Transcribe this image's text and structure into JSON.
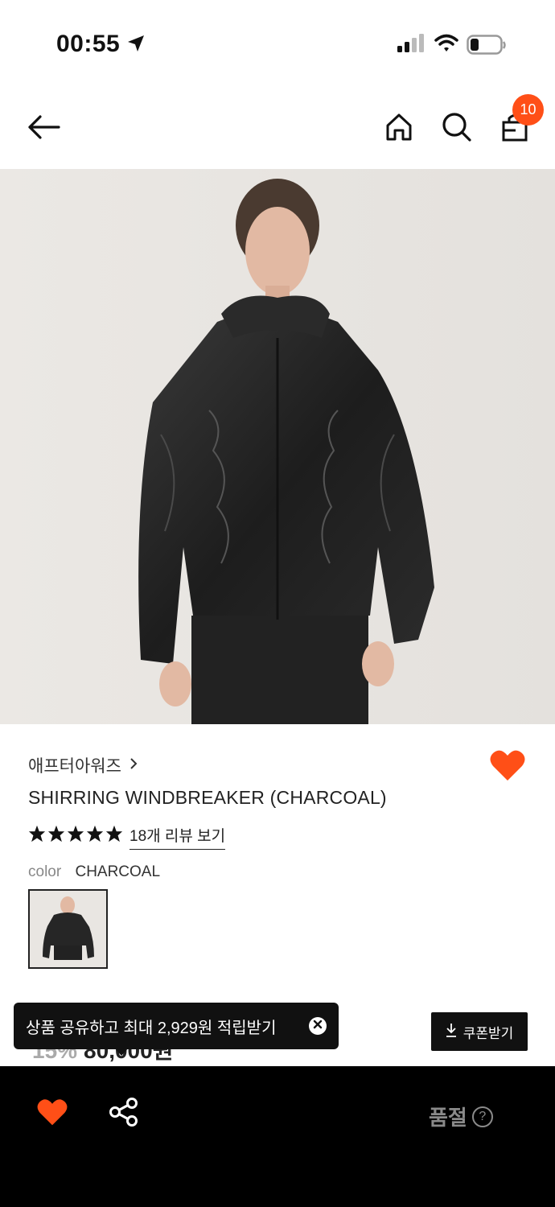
{
  "status_bar": {
    "time": "00:55",
    "icons": [
      "location-arrow-icon",
      "cellular-signal-icon",
      "wifi-icon",
      "battery-icon"
    ]
  },
  "header": {
    "icons": [
      "back-arrow-icon",
      "home-icon",
      "search-icon",
      "shopping-bag-icon"
    ],
    "cart_count": "10",
    "badge_color": "#ff4f17"
  },
  "product": {
    "brand": "애프터아워즈",
    "name": "SHIRRING WINDBREAKER (CHARCOAL)",
    "rating_stars": 5,
    "reviews_link": "18개 리뷰 보기",
    "color_label": "color",
    "color_value": "CHARCOAL",
    "favorite_color": "#ff4f17"
  },
  "price": {
    "partial": "15% 80,000원"
  },
  "toast": {
    "message": "상품 공유하고 최대 2,929원 적립받기"
  },
  "coupon": {
    "label": "쿠폰받기"
  },
  "bottom_bar": {
    "status_label": "품절",
    "help_icon_text": "?"
  }
}
